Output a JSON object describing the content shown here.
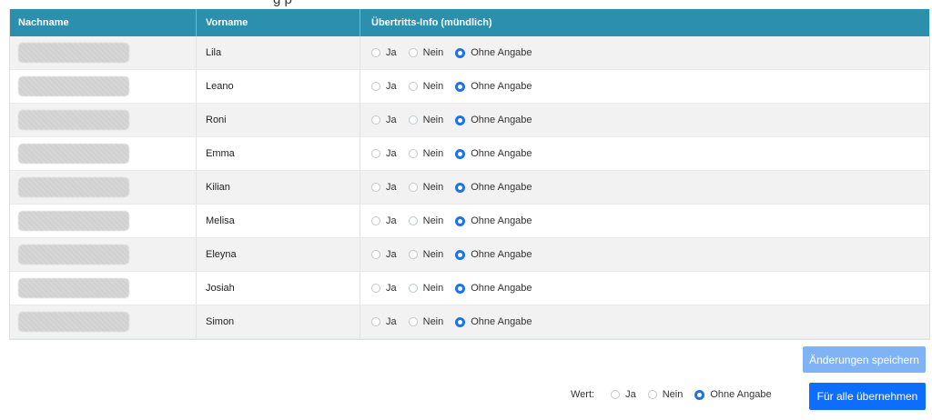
{
  "header_cut_text": "g    p",
  "table": {
    "columns": [
      "Nachname",
      "Vorname",
      "Übertritts-Info (mündlich)"
    ],
    "options": [
      "Ja",
      "Nein",
      "Ohne Angabe"
    ],
    "rows": [
      {
        "vorname": "Lila",
        "selected": "Ohne Angabe"
      },
      {
        "vorname": "Leano",
        "selected": "Ohne Angabe"
      },
      {
        "vorname": "Roni",
        "selected": "Ohne Angabe"
      },
      {
        "vorname": "Emma",
        "selected": "Ohne Angabe"
      },
      {
        "vorname": "Kilian",
        "selected": "Ohne Angabe"
      },
      {
        "vorname": "Melisa",
        "selected": "Ohne Angabe"
      },
      {
        "vorname": "Eleyna",
        "selected": "Ohne Angabe"
      },
      {
        "vorname": "Josiah",
        "selected": "Ohne Angabe"
      },
      {
        "vorname": "Simon",
        "selected": "Ohne Angabe"
      }
    ]
  },
  "actions": {
    "save_label": "Änderungen speichern",
    "apply_label": "Für alle übernehmen",
    "wert_label": "Wert:",
    "wert_selected": "Ohne Angabe"
  },
  "colors": {
    "header_bg": "#2c8fad",
    "radio_selected": "#1a73e8",
    "save_button": "#7fb3f5",
    "apply_button": "#0d6efd"
  }
}
